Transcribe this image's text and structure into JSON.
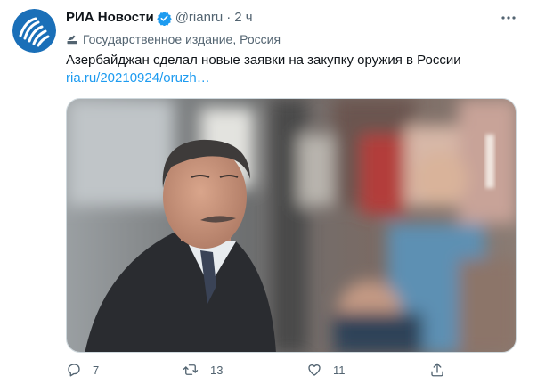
{
  "author": {
    "display_name": "РИА Новости",
    "handle": "@rianru",
    "time": "2 ч",
    "verified": true
  },
  "affiliation": {
    "label": "Государственное издание, Россия"
  },
  "tweet": {
    "text": "Азербайджан сделал новые заявки на закупку оружия в России",
    "link": "ria.ru/20210924/oruzh…"
  },
  "actions": {
    "reply_count": "7",
    "retweet_count": "13",
    "like_count": "11"
  },
  "colors": {
    "accent": "#1d9bf0",
    "secondary_text": "#536471",
    "avatar_bg": "#1a6fb8"
  },
  "icons": {
    "avatar": "ria-logo-icon",
    "verified": "verified-badge-icon",
    "more": "more-options-icon",
    "affiliation": "state-media-icon",
    "reply": "reply-icon",
    "retweet": "retweet-icon",
    "like": "like-icon",
    "share": "share-icon"
  }
}
